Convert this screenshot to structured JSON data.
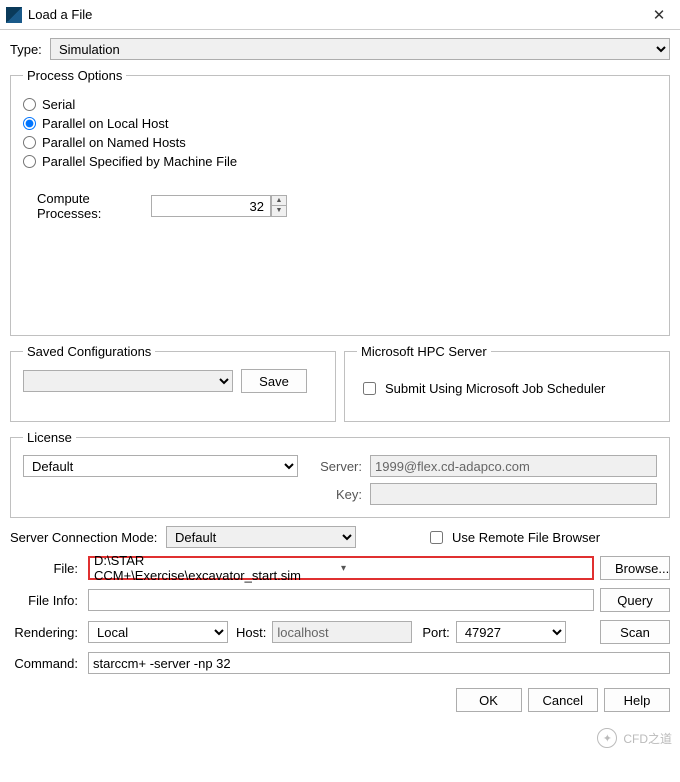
{
  "window": {
    "title": "Load a File"
  },
  "type": {
    "label": "Type:",
    "value": "Simulation"
  },
  "process_options": {
    "legend": "Process Options",
    "options": [
      "Serial",
      "Parallel on Local Host",
      "Parallel on Named Hosts",
      "Parallel Specified by Machine File"
    ],
    "selected_index": 1,
    "compute_label": "Compute Processes:",
    "compute_value": "32"
  },
  "saved_config": {
    "legend": "Saved Configurations",
    "save_btn": "Save"
  },
  "hpc": {
    "legend": "Microsoft HPC Server",
    "submit_label": "Submit Using Microsoft Job Scheduler"
  },
  "license": {
    "legend": "License",
    "value": "Default",
    "server_label": "Server:",
    "server_value": "1999@flex.cd-adapco.com",
    "key_label": "Key:"
  },
  "scm": {
    "label": "Server Connection Mode:",
    "value": "Default",
    "remote_label": "Use Remote File Browser"
  },
  "file": {
    "label": "File:",
    "value": "D:\\STAR CCM+\\Exercise\\excavator_start.sim",
    "browse_btn": "Browse..."
  },
  "file_info": {
    "label": "File Info:",
    "query_btn": "Query"
  },
  "rendering": {
    "label": "Rendering:",
    "value": "Local",
    "host_label": "Host:",
    "host_value": "localhost",
    "port_label": "Port:",
    "port_value": "47927",
    "scan_btn": "Scan"
  },
  "command": {
    "label": "Command:",
    "value": "starccm+ -server -np 32"
  },
  "footer": {
    "ok": "OK",
    "cancel": "Cancel",
    "help": "Help"
  },
  "watermark": "CFD之道"
}
